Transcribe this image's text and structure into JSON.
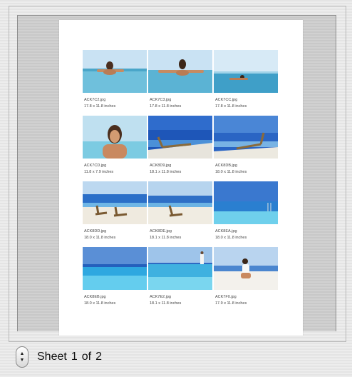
{
  "photos": [
    {
      "name": "ACK7C2.jpg",
      "size": "17.8 x 11.8 inches",
      "scene": "woman-pool-1"
    },
    {
      "name": "ACK7C3.jpg",
      "size": "17.8 x 11.8 inches",
      "scene": "woman-pool-2"
    },
    {
      "name": "ACK7CC.jpg",
      "size": "17.8 x 11.8 inches",
      "scene": "woman-pool-3"
    },
    {
      "name": "ACK7CD.jpg",
      "size": "11.8 x 7.9 inches",
      "scene": "woman-portrait"
    },
    {
      "name": "ACK8D9.jpg",
      "size": "18.1 x 11.8 inches",
      "scene": "lounger-deck-1"
    },
    {
      "name": "ACK8DB.jpg",
      "size": "18.0 x 11.8 inches",
      "scene": "lounger-deck-2"
    },
    {
      "name": "ACK8DD.jpg",
      "size": "18.0 x 11.8 inches",
      "scene": "loungers-beach"
    },
    {
      "name": "ACK8DE.jpg",
      "size": "18.1 x 11.8 inches",
      "scene": "lounger-beach"
    },
    {
      "name": "ACK8EA.jpg",
      "size": "18.0 x 11.8 inches",
      "scene": "pool-sea"
    },
    {
      "name": "ACK8EB.jpg",
      "size": "18.0 x 11.8 inches",
      "scene": "pool-blue"
    },
    {
      "name": "ACK7E2.jpg",
      "size": "18.1 x 11.8 inches",
      "scene": "pool-person"
    },
    {
      "name": "ACK7F0.jpg",
      "size": "17.9 x 11.8 inches",
      "scene": "woman-crouch"
    }
  ],
  "footer": {
    "sheet_word": "Sheet",
    "current": "1",
    "of_word": "of",
    "total": "2",
    "stepper_up": "▲",
    "stepper_down": "▼"
  }
}
